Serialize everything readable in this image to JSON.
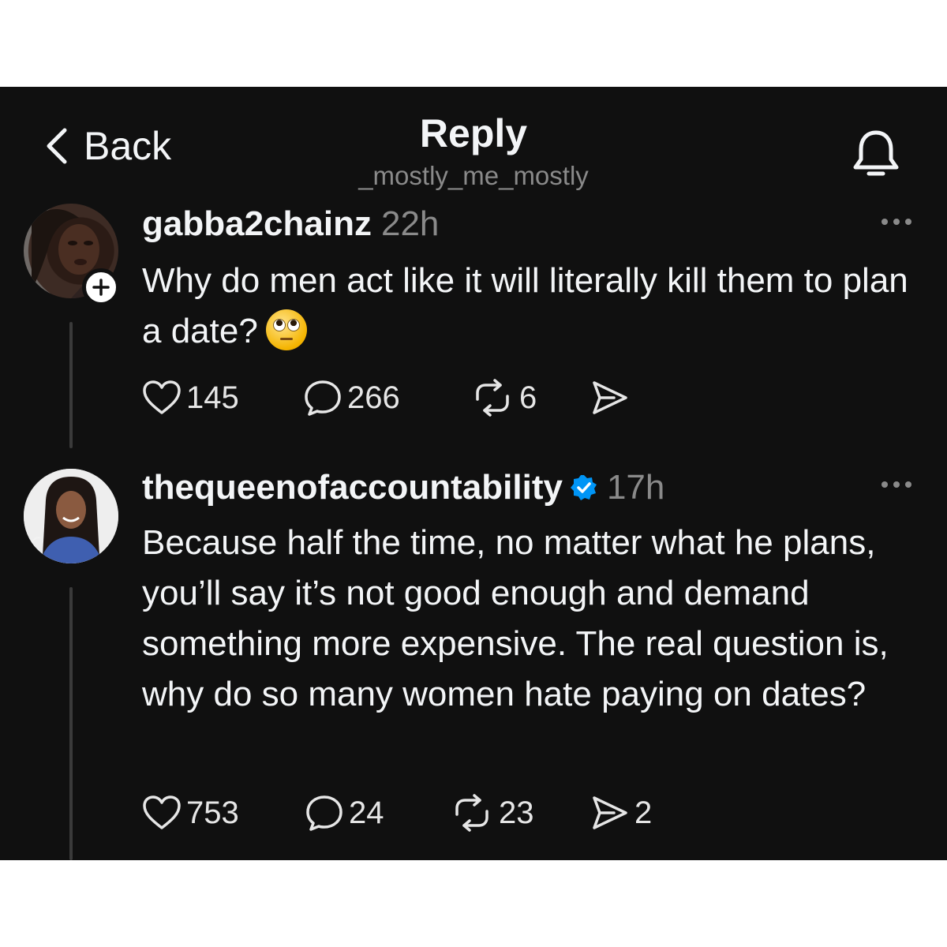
{
  "header": {
    "back_label": "Back",
    "title": "Reply",
    "subtitle": "_mostly_me_mostly"
  },
  "posts": [
    {
      "username": "gabba2chainz",
      "time": "22h",
      "verified": false,
      "text": "Why do men act like it will literally kill them to plan a date?",
      "emoji": "face-with-rolling-eyes",
      "likes": "145",
      "replies": "266",
      "reposts": "6",
      "shares": ""
    },
    {
      "username": "thequeenofaccountability",
      "time": "17h",
      "verified": true,
      "text": "Because half the time, no matter what he plans, you’ll say it’s not good enough and demand something more expensive. The real question is, why do so many women hate paying on dates?",
      "likes": "753",
      "replies": "24",
      "reposts": "23",
      "shares": "2"
    }
  ],
  "colors": {
    "background": "#101010",
    "text": "#f3f5f7",
    "muted": "#8a8a8a",
    "verified": "#0095f6"
  },
  "icons": {
    "back": "chevron-left-icon",
    "notifications": "bell-icon",
    "more": "more-horizontal-icon",
    "follow": "plus-icon",
    "like": "heart-icon",
    "reply": "comment-icon",
    "repost": "repost-icon",
    "share": "send-icon",
    "verified": "verified-badge-icon"
  }
}
